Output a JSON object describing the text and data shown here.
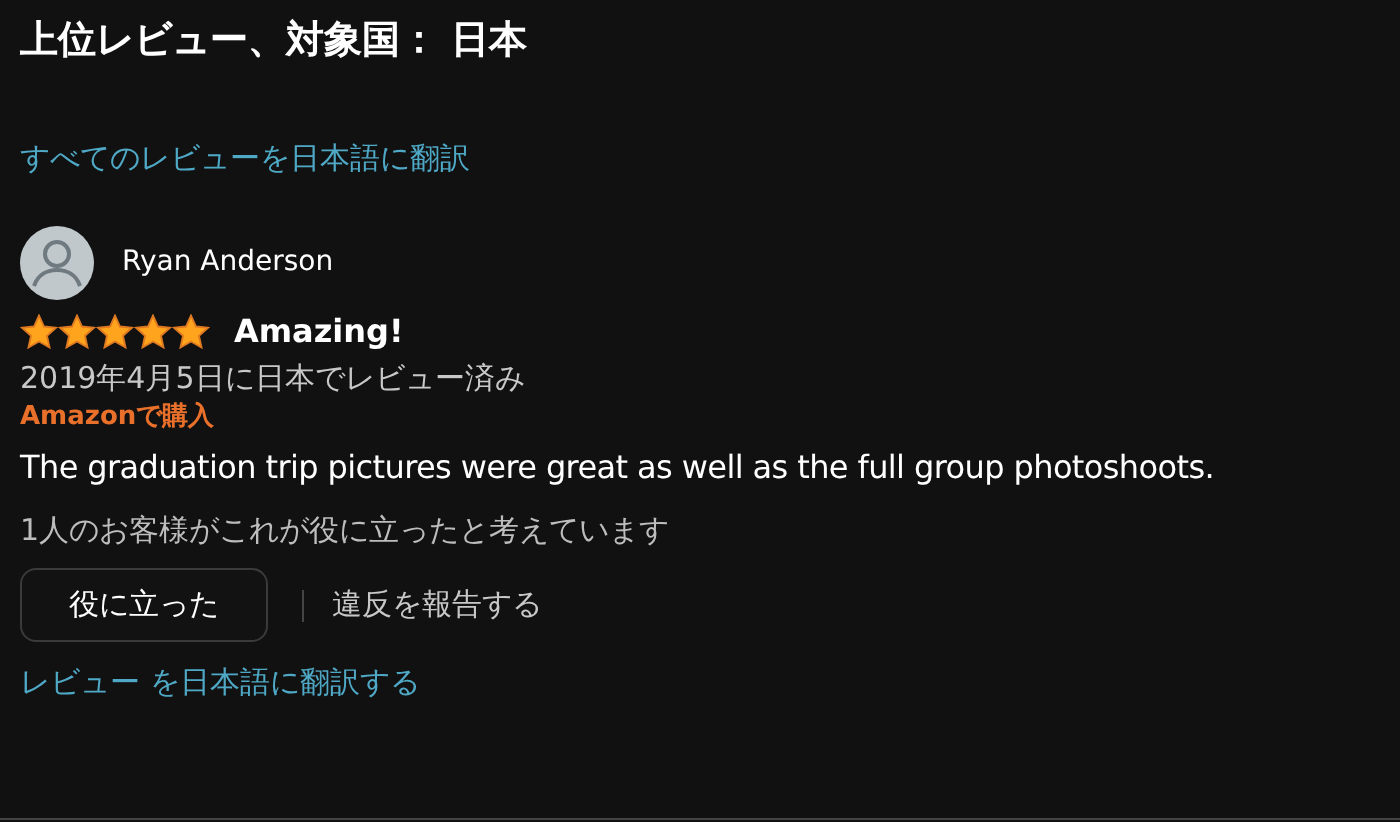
{
  "heading": "上位レビュー、対象国： 日本",
  "translate_all_link": "すべてのレビューを日本語に翻訳",
  "review": {
    "author": "Ryan Anderson",
    "stars": 5,
    "title": "Amazing!",
    "date": "2019年4月5日に日本でレビュー済み",
    "badge": "Amazonで購入",
    "body": "The graduation trip pictures were great as well as the full group photoshoots.",
    "helpful_count": "1人のお客様がこれが役に立ったと考えています",
    "helpful_button": "役に立った",
    "report_link": "違反を報告する",
    "translate_link": "レビュー を日本語に翻訳する"
  }
}
